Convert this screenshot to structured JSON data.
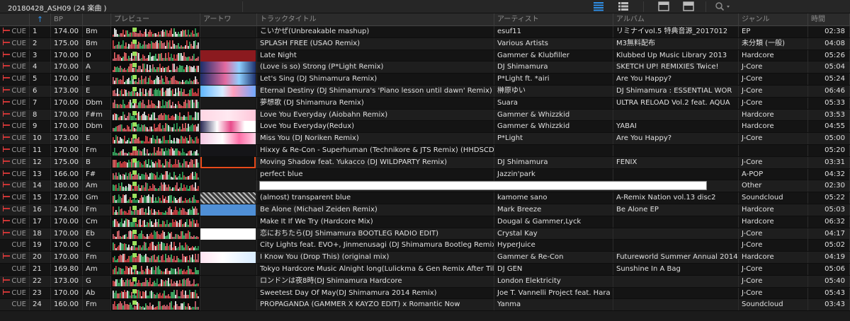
{
  "topbar": {
    "playlist_title": "20180428_ASH09 (24 楽曲 )",
    "icons": [
      "list-view-icon",
      "detail-list-icon",
      "artwork-view-icon",
      "split-view-icon",
      "search-icon"
    ]
  },
  "columns": [
    {
      "key": "cue",
      "label": ""
    },
    {
      "key": "no",
      "label": "↑"
    },
    {
      "key": "bpm",
      "label": "BP"
    },
    {
      "key": "key",
      "label": ""
    },
    {
      "key": "preview",
      "label": "プレビュー"
    },
    {
      "key": "artwork",
      "label": "アートワ"
    },
    {
      "key": "title",
      "label": "トラックタイトル"
    },
    {
      "key": "artist",
      "label": "アーティスト"
    },
    {
      "key": "album",
      "label": "アルバム"
    },
    {
      "key": "genre",
      "label": "ジャンル"
    },
    {
      "key": "time",
      "label": "時間"
    }
  ],
  "colors": {
    "accent": "#2f8fe6",
    "row_odd": "#141414",
    "row_even": "#1e1e1e",
    "cue_marker": "#cc3333"
  },
  "tracks": [
    {
      "cue": "CUE",
      "no": "1",
      "bpm": "174.00",
      "key": "Bm",
      "title": "こいかぜ(Unbreakable mashup)",
      "artist": "esuf11",
      "album": "リミナイvol.5 特典音源_2017012",
      "genre": "EP",
      "time": "02:38",
      "art": ""
    },
    {
      "cue": "CUE",
      "no": "2",
      "bpm": "175.00",
      "key": "Bm",
      "title": "SPLASH FREE (USAO Remix)",
      "artist": "Various Artists",
      "album": "M3無料配布",
      "genre": "未分類 (一般)",
      "time": "04:08",
      "art": ""
    },
    {
      "cue": "CUE",
      "no": "3",
      "bpm": "170.00",
      "key": "D",
      "title": "Late Night",
      "artist": "Gammer & Klubfiller",
      "album": "Klubbed Up Music Library 2013",
      "genre": "Hardcore",
      "time": "05:26",
      "art": "red"
    },
    {
      "cue": "CUE",
      "no": "4",
      "bpm": "170.00",
      "key": "A",
      "title": "(Love is so) Strong (P*Light Remix)",
      "artist": "DJ Shimamura",
      "album": "SKETCH UP! REMIXIES Twice!",
      "genre": "J-Core",
      "time": "05:04",
      "art": "anime-blue"
    },
    {
      "cue": "CUE",
      "no": "5",
      "bpm": "170.00",
      "key": "E",
      "title": "Let's Sing (DJ Shimamura Remix)",
      "artist": "P*Light ft. *airi",
      "album": "Are You Happy?",
      "genre": "J-Core",
      "time": "05:24",
      "art": "anime-blue"
    },
    {
      "cue": "CUE",
      "no": "6",
      "bpm": "173.00",
      "key": "E",
      "title": "Eternal Destiny (DJ Shimamura's 'Piano lesson until dawn' Remix)",
      "artist": "榊原ゆい",
      "album": "DJ Shimamura : ESSENTIAL WOR",
      "genre": "J-Core",
      "time": "06:46",
      "art": "anime-sky"
    },
    {
      "cue": "CUE",
      "no": "7",
      "bpm": "170.00",
      "key": "Dbm",
      "title": "夢想歌 (DJ Shimamura Remix)",
      "artist": "Suara",
      "album": "ULTRA RELOAD Vol.2 feat. AQUA",
      "genre": "J-Core",
      "time": "05:33",
      "art": ""
    },
    {
      "cue": "CUE",
      "no": "8",
      "bpm": "170.00",
      "key": "F#m",
      "title": "Love You Everyday (Aiobahn Remix)",
      "artist": "Gammer & Whizzkid",
      "album": "",
      "genre": "Hardcore",
      "time": "03:53",
      "art": "pink"
    },
    {
      "cue": "CUE",
      "no": "9",
      "bpm": "170.00",
      "key": "Dbm",
      "title": "Love You Everyday(Redux)",
      "artist": "Gammer & Whizzkid",
      "album": "YABAI",
      "genre": "Hardcore",
      "time": "04:55",
      "art": "gammer"
    },
    {
      "cue": "CUE",
      "no": "10",
      "bpm": "173.00",
      "key": "E",
      "title": "Miss You (DJ Noriken Remix)",
      "artist": "P*Light",
      "album": "Are You Happy?",
      "genre": "J-Core",
      "time": "05:00",
      "art": "gammer2"
    },
    {
      "cue": "CUE",
      "no": "11",
      "bpm": "170.00",
      "key": "Fm",
      "title": "Hixxy & Re-Con - Superhuman (Technikore & JTS Remix) (HHDSCD",
      "artist": "",
      "album": "",
      "genre": "",
      "time": "05:20",
      "art": "dark"
    },
    {
      "cue": "CUE",
      "no": "12",
      "bpm": "175.00",
      "key": "B",
      "title": "Moving Shadow feat. Yukacco (DJ WILDPARTY Remix)",
      "artist": "DJ Shimamura",
      "album": "FENIX",
      "genre": "J-Core",
      "time": "03:31",
      "art": "dark-frame"
    },
    {
      "cue": "CUE",
      "no": "13",
      "bpm": "166.00",
      "key": "F#",
      "title": "perfect blue",
      "artist": "Jazzin'park",
      "album": "",
      "genre": "A-POP",
      "time": "04:32",
      "art": ""
    },
    {
      "cue": "CUE",
      "no": "14",
      "bpm": "180.00",
      "key": "Am",
      "title": "",
      "artist": "",
      "album": "",
      "genre": "Other",
      "time": "02:30",
      "art": "",
      "editing": true
    },
    {
      "cue": "CUE",
      "no": "15",
      "bpm": "172.00",
      "key": "Gm",
      "title": "(almost) transparent blue",
      "artist": "kamome sano",
      "album": "A-Remix Nation vol.13 disc2",
      "genre": "Soundcloud",
      "time": "05:22",
      "art": "stripes"
    },
    {
      "cue": "CUE",
      "no": "16",
      "bpm": "174.00",
      "key": "Fm",
      "title": "Be Alone (Michael Zeiden Remix)",
      "artist": "Mark Breeze",
      "album": "Be Alone EP",
      "genre": "Hardcore",
      "time": "05:03",
      "art": "lightblue"
    },
    {
      "cue": "CUE",
      "no": "17",
      "bpm": "170.00",
      "key": "Cm",
      "title": "Make It If We Try (Hardcore Mix)",
      "artist": "Dougal & Gammer,Lyck",
      "album": "",
      "genre": "Hardcore",
      "time": "06:32",
      "art": ""
    },
    {
      "cue": "CUE",
      "no": "18",
      "bpm": "170.00",
      "key": "Eb",
      "title": "恋におちたら(DJ Shimamura BOOTLEG RADIO EDIT)",
      "artist": "Crystal Kay",
      "album": "",
      "genre": "J-Core",
      "time": "04:17",
      "art": "crystalkay"
    },
    {
      "cue": "CUE",
      "no": "19",
      "bpm": "170.00",
      "key": "C",
      "title": "City Lights feat. EVO+, Jinmenusagi (DJ Shimamura Bootleg Remix)",
      "artist": "HyperJuice",
      "album": "",
      "genre": "J-Core",
      "time": "05:02",
      "art": ""
    },
    {
      "cue": "CUE",
      "no": "20",
      "bpm": "170.00",
      "key": "Fm",
      "title": "I Know You (Drop This) (original mix)",
      "artist": "Gammer & Re-Con",
      "album": "Futureworld Summer Annual 2014",
      "genre": "Hardcore",
      "time": "04:19",
      "art": "pastel"
    },
    {
      "cue": "CUE",
      "no": "21",
      "bpm": "169.80",
      "key": "Am",
      "title": "Tokyo Hardcore Music Alnight long(Lulickma & Gen Remix After Till T",
      "artist": "DJ GEN",
      "album": "Sunshine In A Bag",
      "genre": "J-Core",
      "time": "05:06",
      "art": ""
    },
    {
      "cue": "CUE",
      "no": "22",
      "bpm": "173.00",
      "key": "G",
      "title": "ロンドンは夜8時(DJ Shimamura Hardcore",
      "artist": "London Elektricity",
      "album": "",
      "genre": "J-Core",
      "time": "05:40",
      "art": ""
    },
    {
      "cue": "CUE",
      "no": "23",
      "bpm": "170.00",
      "key": "Ab",
      "title": "Sweetest Day Of May(DJ Shimamura 2014 Remix)",
      "artist": "Joe T. Vannelli Project feat. Hara",
      "album": "",
      "genre": "J-Core",
      "time": "05:43",
      "art": ""
    },
    {
      "cue": "CUE",
      "no": "24",
      "bpm": "160.00",
      "key": "Fm",
      "title": "PROPAGANDA (GAMMER X KAYZO EDIT) x Romantic Now",
      "artist": "Yanma",
      "album": "",
      "genre": "Soundcloud",
      "time": "03:43",
      "art": ""
    }
  ]
}
